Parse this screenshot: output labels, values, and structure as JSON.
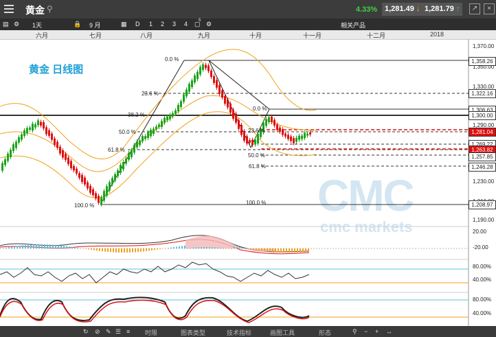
{
  "header": {
    "title": "黄金",
    "change_pct": "4.33%",
    "bid": "1,281.49",
    "ask": "1,281.79"
  },
  "toolbar": {
    "interval": "1天",
    "month": "9 月",
    "d_label": "D",
    "nums": [
      "1",
      "2",
      "3",
      "4"
    ],
    "badge": "5",
    "related": "相关产品"
  },
  "timeline": [
    "六月",
    "七月",
    "八月",
    "九月",
    "十月",
    "十一月",
    "十二月",
    "2018"
  ],
  "chart_title": "黄金 日线图",
  "watermark": {
    "logo": "CMC",
    "text": "cmc markets"
  },
  "price_axis": [
    "1,370.00",
    "1,350.00",
    "1,330.00",
    "1,290.00",
    "1,230.00",
    "1,210.00",
    "1,190.00"
  ],
  "price_flags": [
    {
      "label": "1,358.26",
      "color": "#ffffff",
      "text": "#222"
    },
    {
      "label": "1,322.16",
      "color": "#ffffff",
      "text": "#222"
    },
    {
      "label": "1,306.63",
      "color": "#ffffff",
      "text": "#222"
    },
    {
      "label": "1,300.00",
      "color": "#ffffff",
      "text": "#222"
    },
    {
      "label": "1,281.04",
      "color": "#e01010",
      "text": "#ffffff"
    },
    {
      "label": "1,269.22",
      "color": "#ffffff",
      "text": "#222"
    },
    {
      "label": "1,263.82",
      "color": "#e01010",
      "text": "#ffffff"
    },
    {
      "label": "1,257.85",
      "color": "#ffffff",
      "text": "#222"
    },
    {
      "label": "1,246.28",
      "color": "#ffffff",
      "text": "#222"
    },
    {
      "label": "1,208.97",
      "color": "#ffffff",
      "text": "#222"
    }
  ],
  "fib_labels": [
    "0.0 %",
    "23.6 %",
    "38.2 %",
    "50.0 %",
    "61.8 %",
    "100.0 %",
    "0.0 %",
    "23.6 %",
    "50.0 %",
    "61.8 %",
    "100.0 %"
  ],
  "indicators": {
    "macd_axis": [
      "20.00",
      "-20.00"
    ],
    "rsi_axis": [
      "80.00%",
      "40.00%"
    ],
    "stoch_axis": [
      "80.00%",
      "40.00%"
    ]
  },
  "bottom_tabs": [
    "时限",
    "图表类型",
    "技术指标",
    "画图工具",
    "形态"
  ],
  "colors": {
    "accent": "#1fa0d6",
    "up": "#1aa51a",
    "down": "#e01010",
    "ma": "#f0a21a"
  }
}
